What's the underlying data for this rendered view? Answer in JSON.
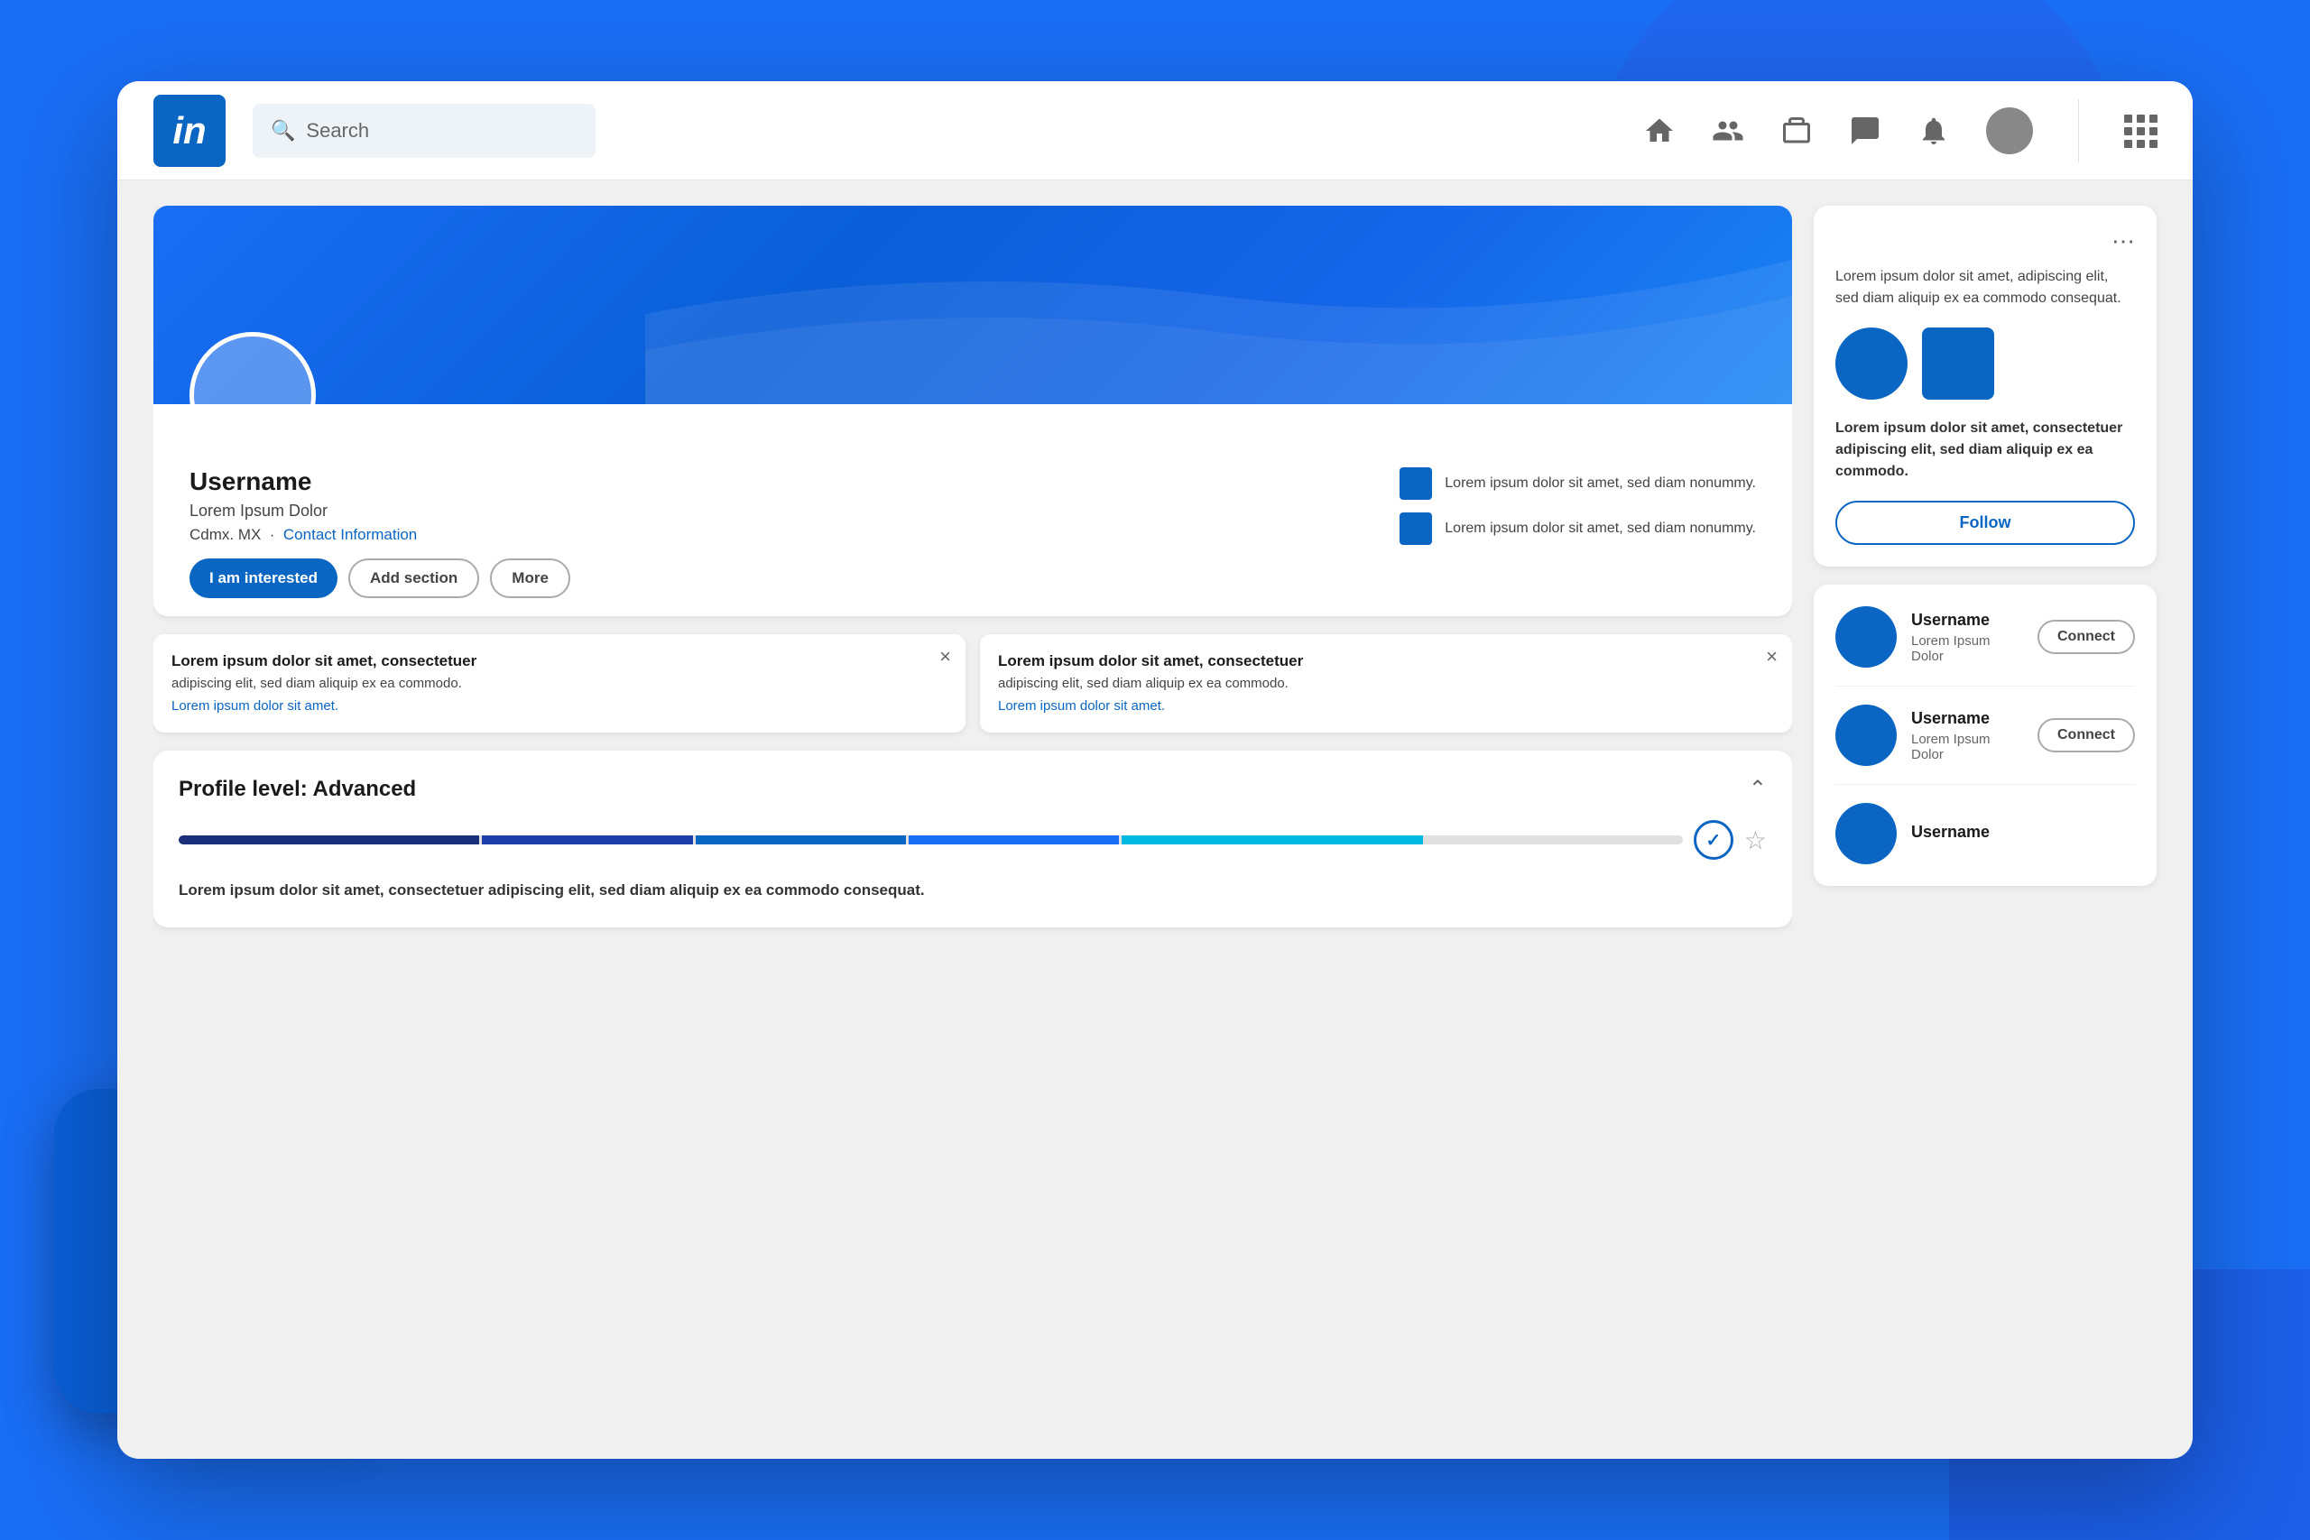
{
  "background": {
    "color": "#1a6ef5"
  },
  "nav": {
    "logo_text": "in",
    "search_placeholder": "Search",
    "icons": [
      "home",
      "people",
      "briefcase",
      "chat",
      "bell",
      "avatar",
      "grid"
    ]
  },
  "profile": {
    "username": "Username",
    "title": "Lorem Ipsum Dolor",
    "location_city": "Cdmx. MX",
    "location_link": "Contact Information",
    "stat1_text": "Lorem ipsum dolor sit amet, sed diam nonummy.",
    "stat2_text": "Lorem ipsum dolor sit amet, sed diam nonummy.",
    "btn_interested": "I am interested",
    "btn_add_section": "Add section",
    "btn_more": "More"
  },
  "suggestions": [
    {
      "title": "Lorem ipsum dolor sit amet, consectetuer",
      "body": "adipiscing elit, sed diam aliquip ex ea commodo.",
      "link": "Lorem ipsum dolor sit amet."
    },
    {
      "title": "Lorem ipsum dolor sit amet, consectetuer",
      "body": "adipiscing elit, sed diam aliquip ex ea commodo.",
      "link": "Lorem ipsum dolor sit amet."
    }
  ],
  "profile_level": {
    "label": "Profile level: Advanced",
    "description_bold": "Lorem ipsum dolor sit amet, consectetuer adipiscing elit,",
    "description_rest": " sed diam aliquip ex ea commodo consequat.",
    "progress_segments": [
      {
        "color": "#1a3a8f",
        "pct": 20
      },
      {
        "color": "#1a3aaa",
        "pct": 15
      },
      {
        "color": "#0a66c2",
        "pct": 15
      },
      {
        "color": "#1a6ef5",
        "pct": 15
      },
      {
        "color": "#00b0d8",
        "pct": 20
      },
      {
        "color": "#e0e0e0",
        "pct": 15
      }
    ]
  },
  "right_ad": {
    "dots_label": "more options",
    "desc": "Lorem ipsum dolor sit amet, adipiscing elit, sed diam aliquip ex ea commodo consequat.",
    "body": "Lorem ipsum dolor sit amet, consectetuer adipiscing elit, sed diam aliquip ex ea commodo.",
    "follow_label": "Follow"
  },
  "people": [
    {
      "name": "Username",
      "title": "Lorem Ipsum Dolor",
      "connect_label": "Connect"
    },
    {
      "name": "Username",
      "title": "Lorem Ipsum Dolor",
      "connect_label": "Connect"
    },
    {
      "name": "Username",
      "title": "",
      "connect_label": ""
    }
  ]
}
